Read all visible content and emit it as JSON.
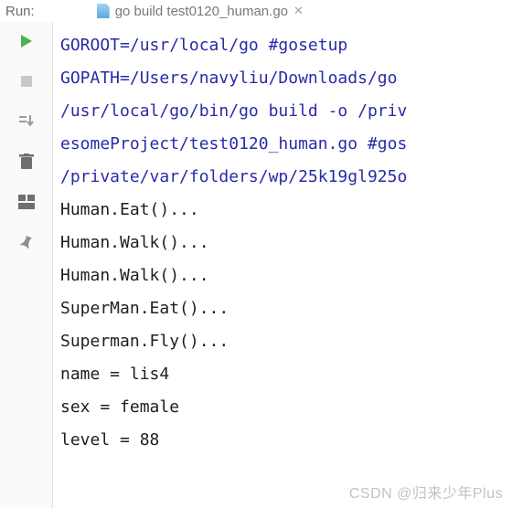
{
  "topbar": {
    "run_label": "Run:",
    "tab_label": "go build test0120_human.go"
  },
  "tools": {
    "run": "run-icon",
    "stop": "stop-icon",
    "down": "step-down-icon",
    "trash": "trash-icon",
    "layout": "layout-icon",
    "pin": "pin-icon"
  },
  "console": {
    "lines": [
      {
        "cls": "cmd",
        "text": "GOROOT=/usr/local/go #gosetup"
      },
      {
        "cls": "cmd",
        "text": "GOPATH=/Users/navyliu/Downloads/go"
      },
      {
        "cls": "cmd",
        "text": "/usr/local/go/bin/go build -o /priv"
      },
      {
        "cls": "cmd",
        "text": "esomeProject/test0120_human.go #gos"
      },
      {
        "cls": "cmd",
        "text": "/private/var/folders/wp/25k19gl925o"
      },
      {
        "cls": "out",
        "text": "Human.Eat()..."
      },
      {
        "cls": "out",
        "text": "Human.Walk()..."
      },
      {
        "cls": "out",
        "text": "Human.Walk()..."
      },
      {
        "cls": "out",
        "text": "SuperMan.Eat()..."
      },
      {
        "cls": "out",
        "text": "Superman.Fly()..."
      },
      {
        "cls": "out",
        "text": "name =  lis4"
      },
      {
        "cls": "out",
        "text": "sex =  female"
      },
      {
        "cls": "out",
        "text": "level =  88"
      }
    ]
  },
  "watermark": "CSDN @归来少年Plus"
}
